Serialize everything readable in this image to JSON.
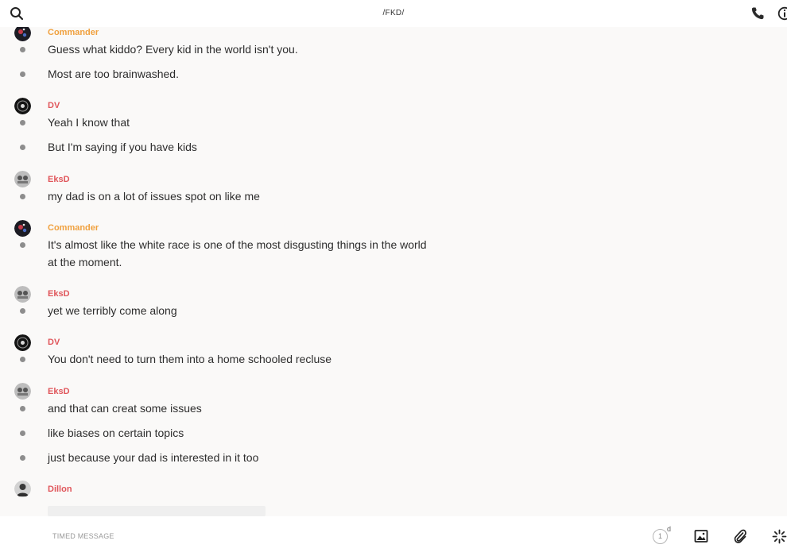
{
  "header": {
    "title": "/FKD/",
    "icons": [
      "search-icon",
      "phone-icon",
      "info-icon"
    ]
  },
  "messages": [
    {
      "author": "Commander",
      "author_color": "#f0a13f",
      "avatar": "avatar-commander",
      "lines": [
        "Guess what kiddo? Every kid in the world isn't you.",
        "Most are too brainwashed."
      ]
    },
    {
      "author": "DV",
      "author_color": "#e0565b",
      "avatar": "avatar-dv",
      "lines": [
        "Yeah I know that",
        "But I'm saying if you have kids"
      ]
    },
    {
      "author": "EksD",
      "author_color": "#e0565b",
      "avatar": "avatar-eksd",
      "lines": [
        "my dad is on a lot of issues spot on like me"
      ]
    },
    {
      "author": "Commander",
      "author_color": "#f0a13f",
      "avatar": "avatar-commander",
      "lines": [
        "It's almost like the white race is one of the most disgusting things in the world",
        "at the moment."
      ]
    },
    {
      "author": "EksD",
      "author_color": "#e0565b",
      "avatar": "avatar-eksd",
      "lines": [
        "yet we terribly come along"
      ]
    },
    {
      "author": "DV",
      "author_color": "#e0565b",
      "avatar": "avatar-dv",
      "lines": [
        "You don't need to turn them into a home schooled recluse"
      ]
    },
    {
      "author": "EksD",
      "author_color": "#e0565b",
      "avatar": "avatar-eksd",
      "lines": [
        "and that can creat some issues",
        "like biases on certain topics",
        "just because your dad is interested in it too"
      ]
    },
    {
      "author": "Dillon",
      "author_color": "#e0565b",
      "avatar": "avatar-dillon",
      "lines": []
    }
  ],
  "composer": {
    "placeholder": "TIMED MESSAGE",
    "timer_value": "1",
    "timer_unit": "d",
    "icons": [
      "image-icon",
      "paperclip-icon",
      "sparkle-icon"
    ]
  },
  "colors": {
    "accent_orange": "#f0a13f",
    "accent_red": "#e0565b",
    "background": "#faf9f8"
  }
}
